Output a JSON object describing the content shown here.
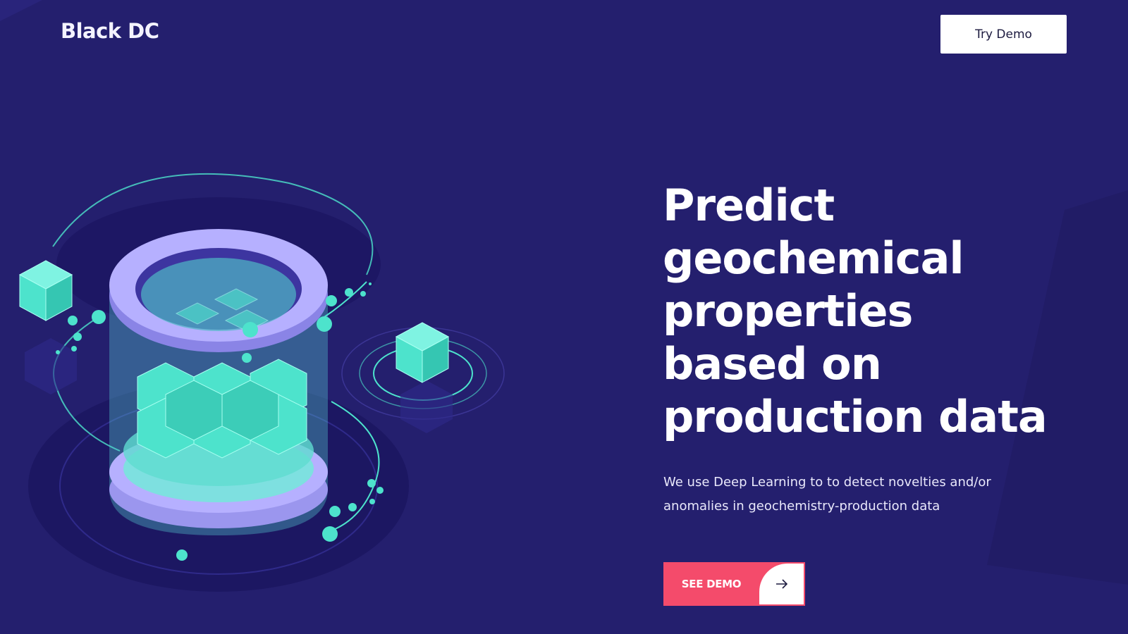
{
  "header": {
    "logo": "Black DC",
    "try_demo_label": "Try Demo"
  },
  "hero": {
    "title_lines": [
      "Predict",
      "geochemical",
      "properties",
      "based on",
      "production data"
    ],
    "subtitle_line1": "We use Deep Learning to to detect novelties and/or",
    "subtitle_line2": "anomalies in geochemistry-production data",
    "cta_label": "SEE DEMO",
    "cta_icon": "arrow-right-icon"
  },
  "colors": {
    "background": "#241f6e",
    "accent": "#f44b6b",
    "teal": "#4de3cc",
    "lavender": "#b6b0ff"
  }
}
